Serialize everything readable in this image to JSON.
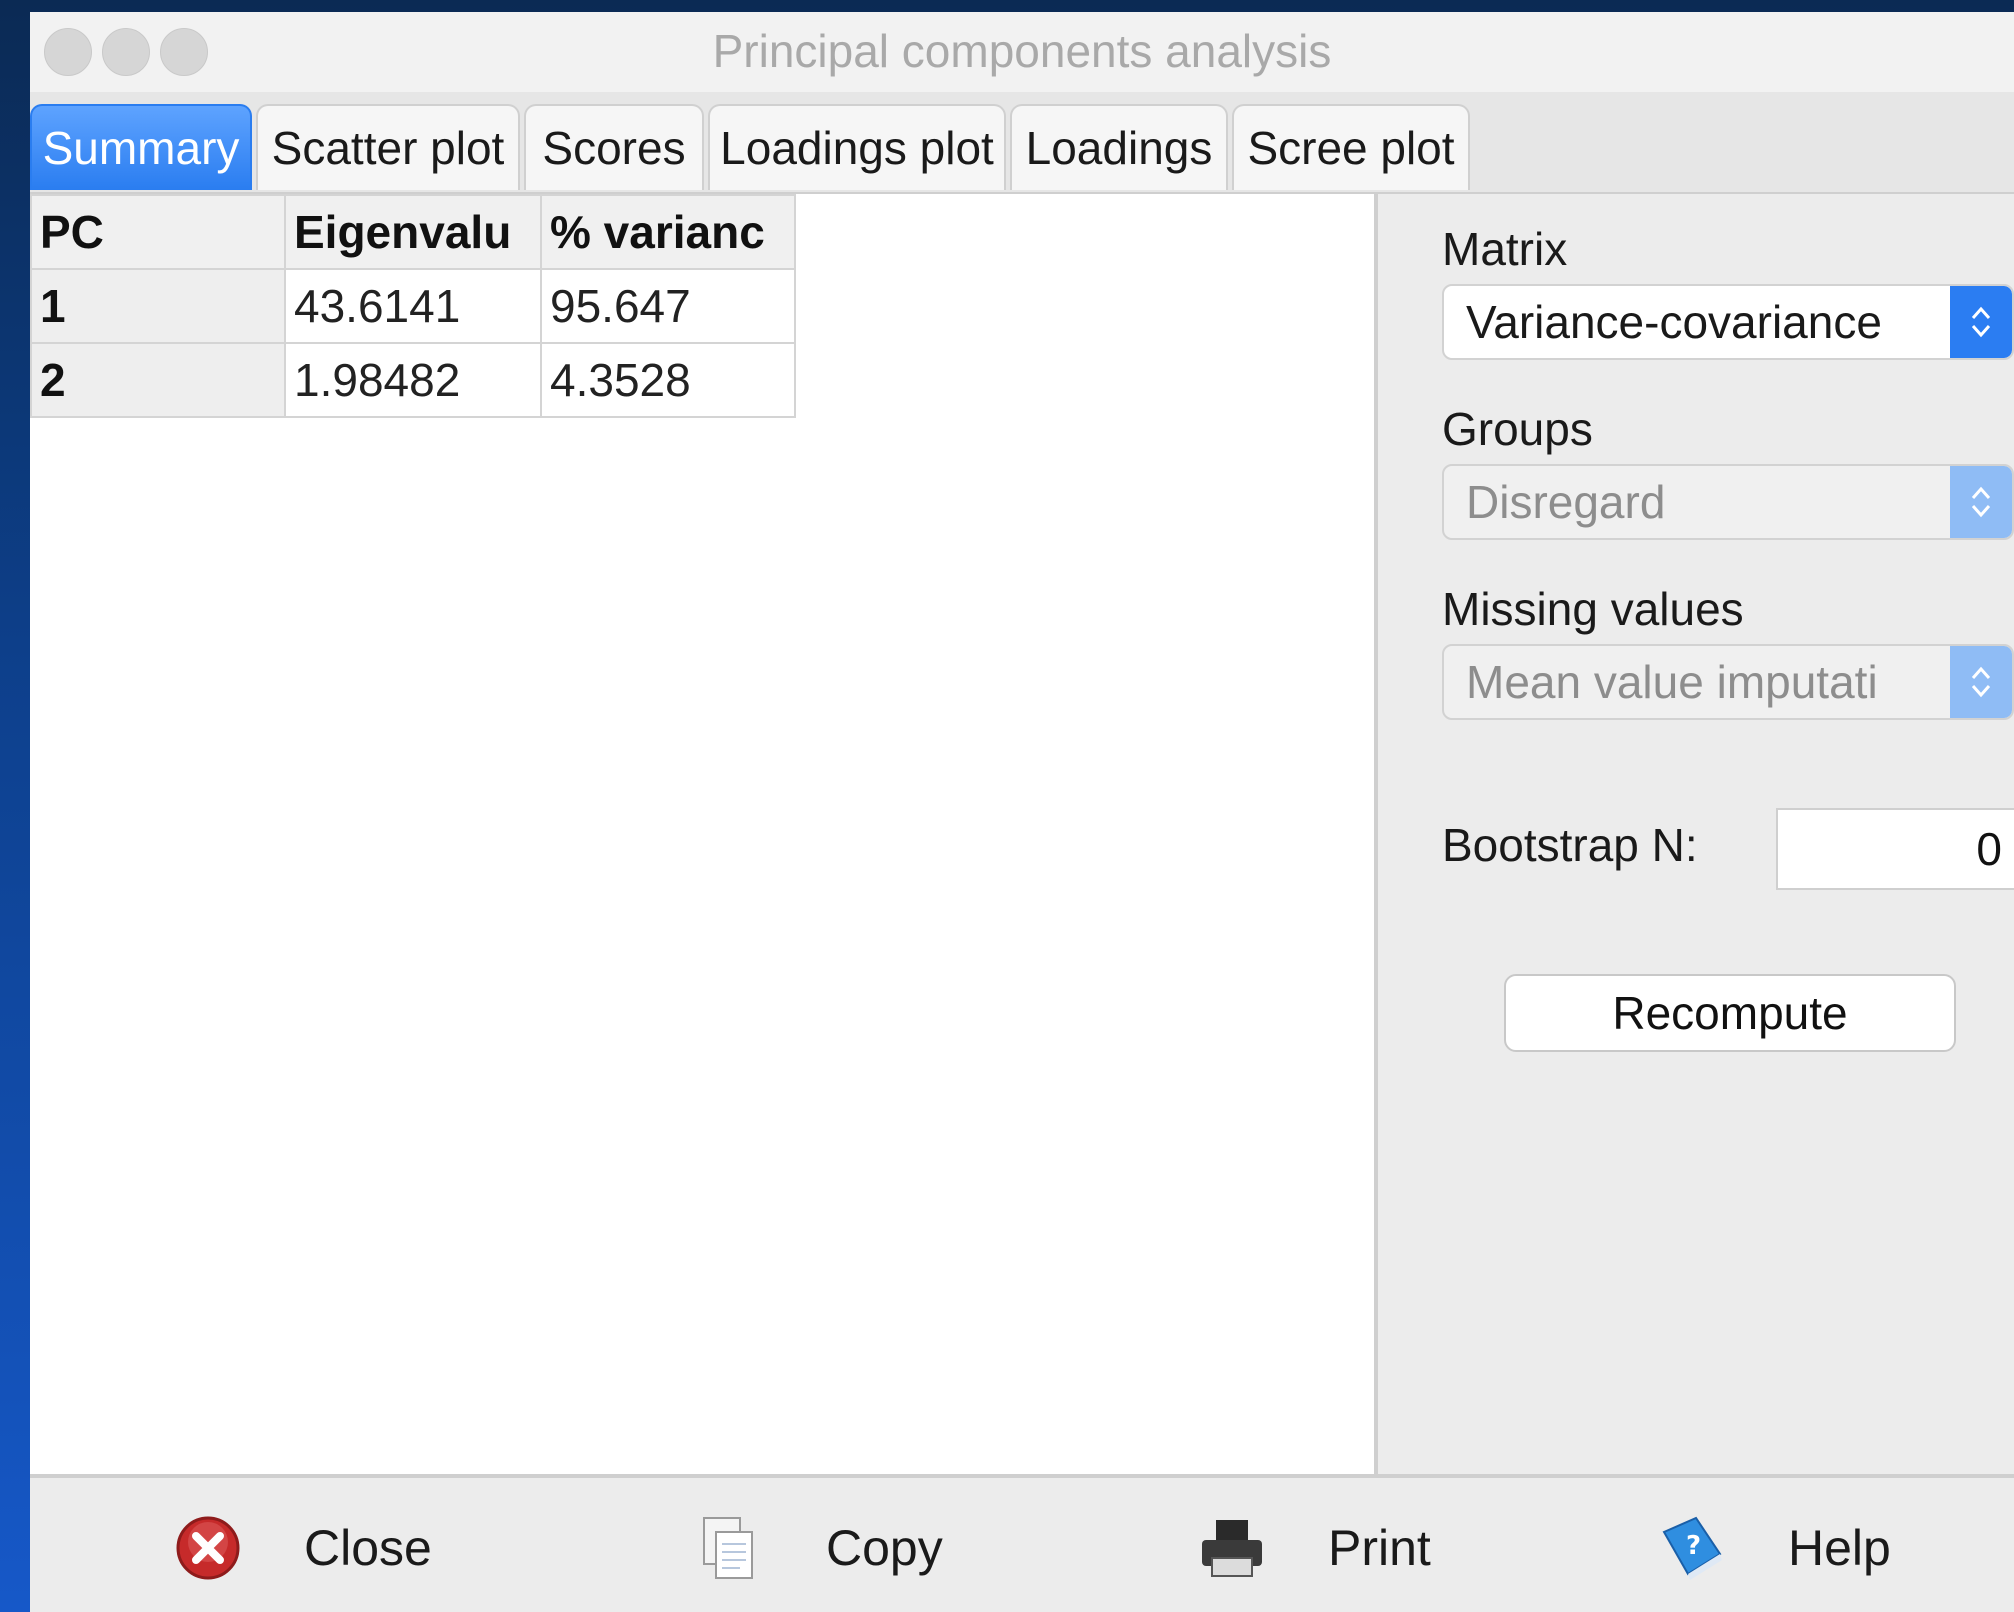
{
  "window": {
    "title": "Principal components analysis"
  },
  "tabs": [
    {
      "label": "Summary",
      "active": true
    },
    {
      "label": "Scatter plot"
    },
    {
      "label": "Scores"
    },
    {
      "label": "Loadings plot"
    },
    {
      "label": "Loadings"
    },
    {
      "label": "Scree plot"
    }
  ],
  "summary_table": {
    "headers": [
      "PC",
      "Eigenvalu",
      "% varianc"
    ],
    "rows": [
      [
        "1",
        "43.6141",
        "95.647"
      ],
      [
        "2",
        "1.98482",
        "4.3528"
      ]
    ]
  },
  "options": {
    "matrix": {
      "label": "Matrix",
      "value": "Variance-covariance"
    },
    "groups": {
      "label": "Groups",
      "value": "Disregard"
    },
    "missing": {
      "label": "Missing values",
      "value": "Mean value imputati"
    },
    "bootstrap": {
      "label": "Bootstrap N:",
      "value": "0"
    },
    "recompute_label": "Recompute"
  },
  "bottom_buttons": {
    "close": {
      "label": "Close",
      "icon": "close-icon"
    },
    "copy": {
      "label": "Copy",
      "icon": "copy-icon"
    },
    "print": {
      "label": "Print",
      "icon": "print-icon"
    },
    "help": {
      "label": "Help",
      "icon": "help-icon"
    }
  },
  "colors": {
    "accent": "#2a7df0",
    "close_red": "#c62a2a"
  }
}
